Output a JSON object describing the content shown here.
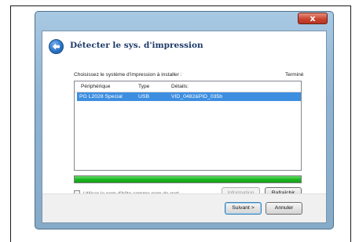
{
  "window": {
    "close_glyph": "x",
    "title": "Détecter le sys. d'impression"
  },
  "content": {
    "instruction": "Choisissez le système d'impression à installer :",
    "status": "Terminé"
  },
  "table": {
    "columns": [
      "Périphérique",
      "Type",
      "Détails:"
    ],
    "rows": [
      {
        "device": "PG L2028 Special",
        "type": "USB",
        "details": "VID_0482&PID_035b",
        "selected": true
      }
    ]
  },
  "progress": {
    "value_percent": 100,
    "color": "#1ab31f"
  },
  "options": {
    "hostname_checkbox_label": "Utiliser le nom d'hôte comme nom de port",
    "hostname_checked": false
  },
  "buttons": {
    "information": "Information",
    "refresh": "Rafraîchir",
    "next": "Suivant >",
    "cancel": "Annuler"
  },
  "colors": {
    "selection": "#3d8ee0",
    "title_text": "#1d3a6a",
    "accent_frame": "#8fb3d2"
  }
}
